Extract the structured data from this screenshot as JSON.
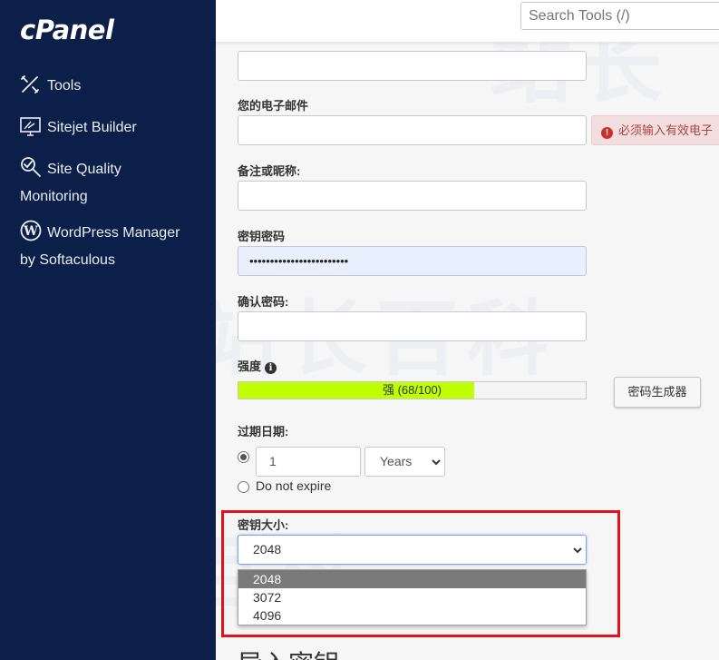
{
  "sidebar": {
    "logo": "cPanel",
    "items": [
      {
        "label": "Tools",
        "icon": "tools-icon"
      },
      {
        "label": "Sitejet Builder",
        "icon": "sitejet-icon"
      },
      {
        "label": "Site Quality",
        "label_cont": "Monitoring",
        "icon": "site-quality-icon"
      },
      {
        "label": "WordPress Manager",
        "label_cont": "by Softaculous",
        "icon": "wordpress-icon"
      }
    ]
  },
  "topbar": {
    "search_placeholder": "Search Tools (/)"
  },
  "form": {
    "email_label": "您的电子邮件",
    "email_error": "必须输入有效电子",
    "comment_label": "备注或昵称:",
    "password_label": "密钥密码",
    "password_value": "••••••••••••••••••••••••",
    "confirm_label": "确认密码:",
    "strength_label": "强度",
    "strength_text": "强 (68/100)",
    "strength_value": 68,
    "generator_button": "密码生成器",
    "expiry_label": "过期日期:",
    "expiry_value": "1",
    "expiry_unit": "Years",
    "no_expire_label": "Do not expire",
    "keysize_label": "密钥大小:",
    "keysize_selected": "2048",
    "keysize_options": [
      "2048",
      "3072",
      "4096"
    ],
    "next_heading": "导入密钥"
  },
  "colors": {
    "sidebar_bg": "#0b1f49",
    "strength_fill": "#bfff00",
    "highlight": "#e0141a",
    "error_bg": "#f2dede"
  }
}
